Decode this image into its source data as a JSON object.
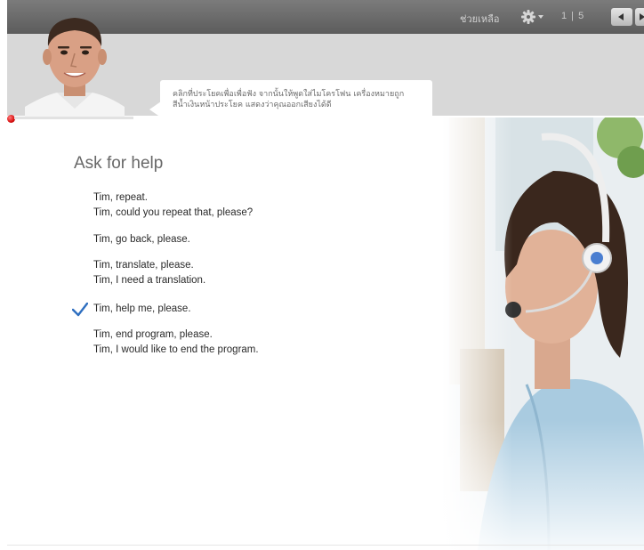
{
  "toolbar": {
    "help_label": "ช่วยเหลือ",
    "settings_icon": "gear-icon",
    "page_indicator": "1 | 5",
    "prev_icon": "triangle-left-icon",
    "next_icon": "triangle-right-icon"
  },
  "header": {
    "avatar": "tim-avatar",
    "speech_text": "คลิกที่ประโยคเพื่อเพื่อฟัง จากนั้นให้พูดใส่ไมโครโฟน เครื่องหมายถูกสีน้ำเงินหน้าประโยค แสดงว่าคุณออกเสียงได้ดี"
  },
  "main": {
    "title": "Ask for help",
    "groups": [
      {
        "lines": [
          "Tim, repeat.",
          "Tim, could you repeat that, please?"
        ],
        "checked": false
      },
      {
        "lines": [
          "Tim, go back, please."
        ],
        "checked": false
      },
      {
        "lines": [
          "Tim, translate, please.",
          "Tim, I need a translation."
        ],
        "checked": false
      },
      {
        "lines": [
          "Tim, help me, please."
        ],
        "checked": true
      },
      {
        "lines": [
          "Tim, end program, please.",
          "Tim, I would like to end the program."
        ],
        "checked": false
      }
    ]
  },
  "colors": {
    "toolbar": "#666666",
    "header_band": "#d8d8d8",
    "checkmark": "#2f6fc0",
    "record": "#d80f0f"
  }
}
